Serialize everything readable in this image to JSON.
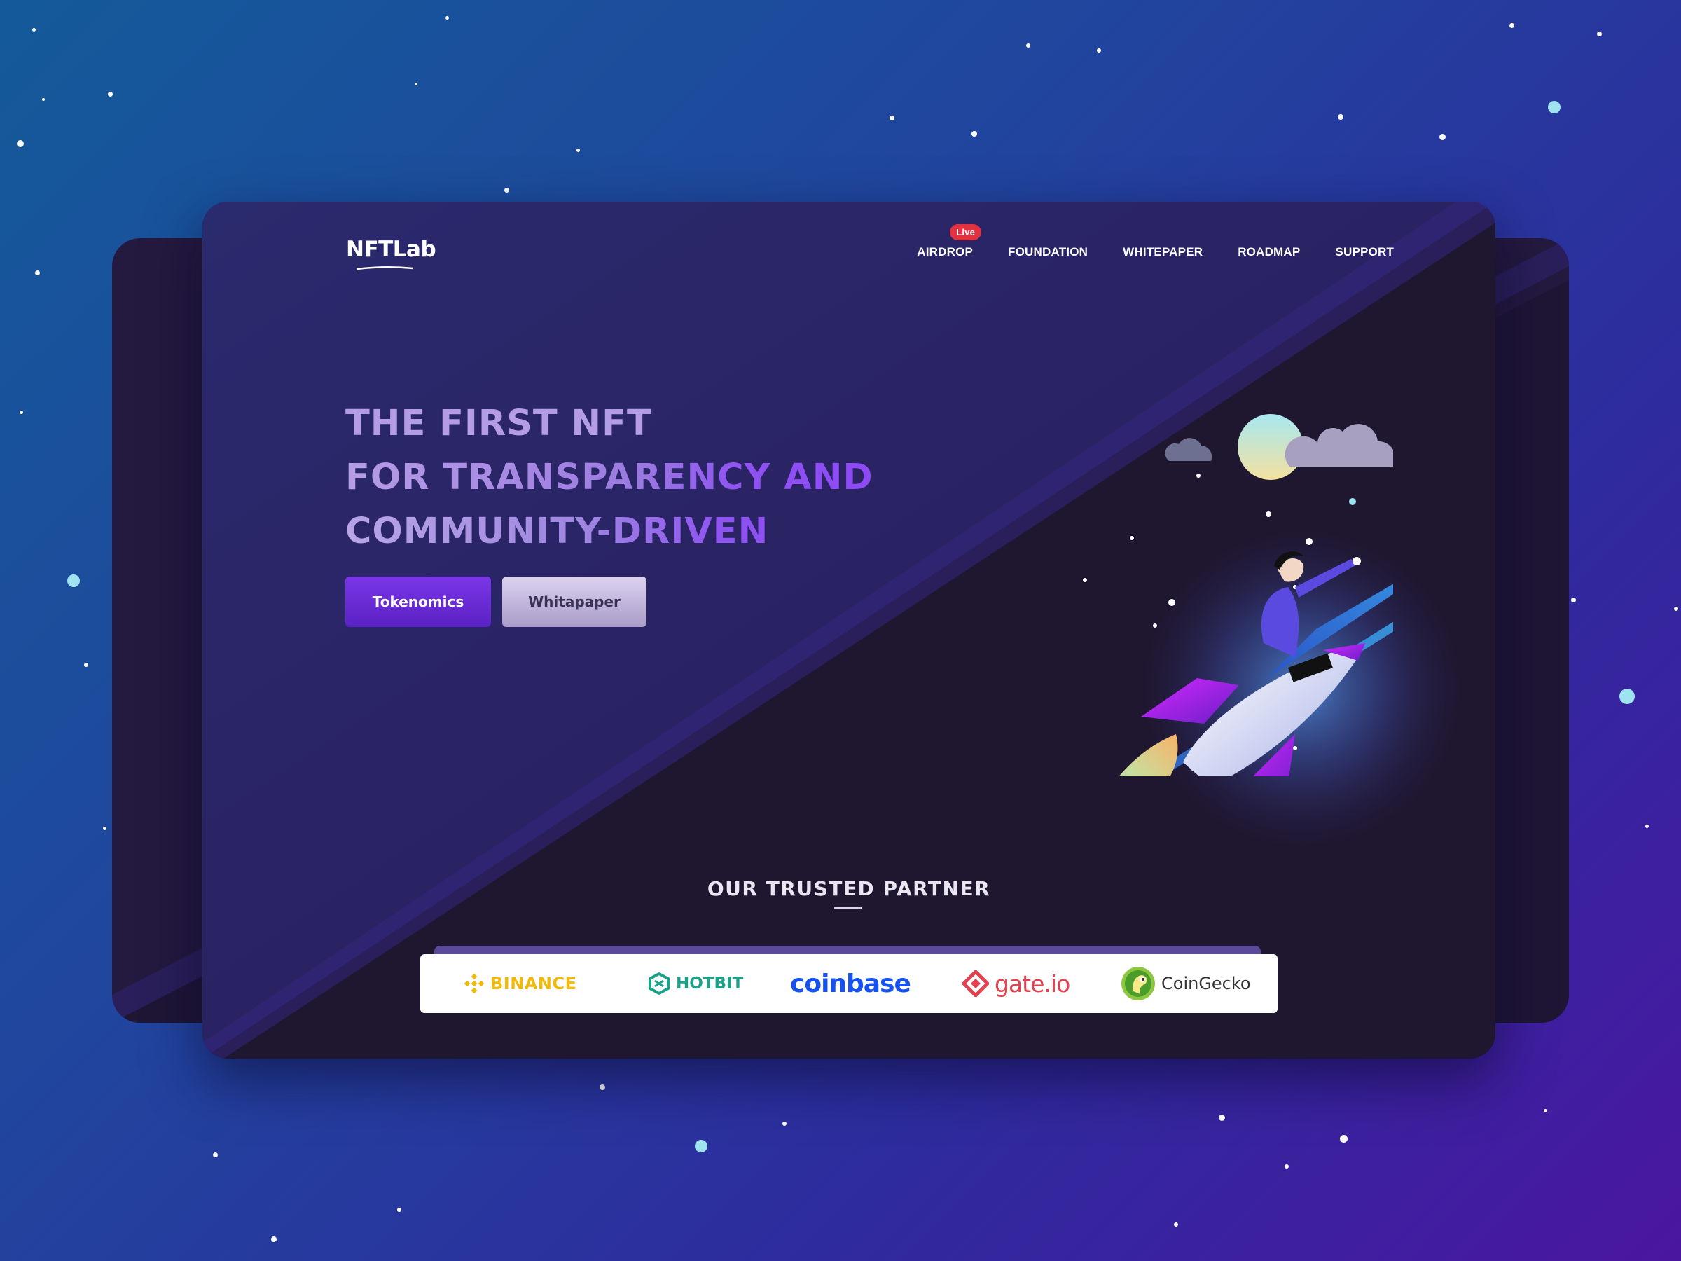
{
  "brand": {
    "logo": "NFTLab"
  },
  "nav": {
    "items": [
      {
        "label": "AIRDROP",
        "badge": "Live"
      },
      {
        "label": "FOUNDATION"
      },
      {
        "label": "WHITEPAPER"
      },
      {
        "label": "ROADMAP"
      },
      {
        "label": "SUPPORT"
      }
    ]
  },
  "hero": {
    "headline_line1": "THE FIRST NFT",
    "headline_line2": "FOR TRANSPARENCY AND",
    "headline_line3": "COMMUNITY-DRIVEN",
    "primary_button": "Tokenomics",
    "secondary_button": "Whitapaper"
  },
  "partners": {
    "title": "OUR TRUSTED PARTNER",
    "items": [
      "BINANCE",
      "HOTBIT",
      "coinbase",
      "gate.io",
      "CoinGecko"
    ]
  },
  "colors": {
    "accent": "#6a2be0",
    "live_badge": "#e2323f",
    "binance": "#f0b90b",
    "hotbit": "#1ba38a",
    "coinbase": "#1652f0",
    "gate": "#e5404d"
  },
  "icons": [
    "rocket-illustration",
    "moon-icon",
    "cloud-icon",
    "binance-icon",
    "hotbit-icon",
    "gate-icon",
    "coingecko-icon"
  ]
}
